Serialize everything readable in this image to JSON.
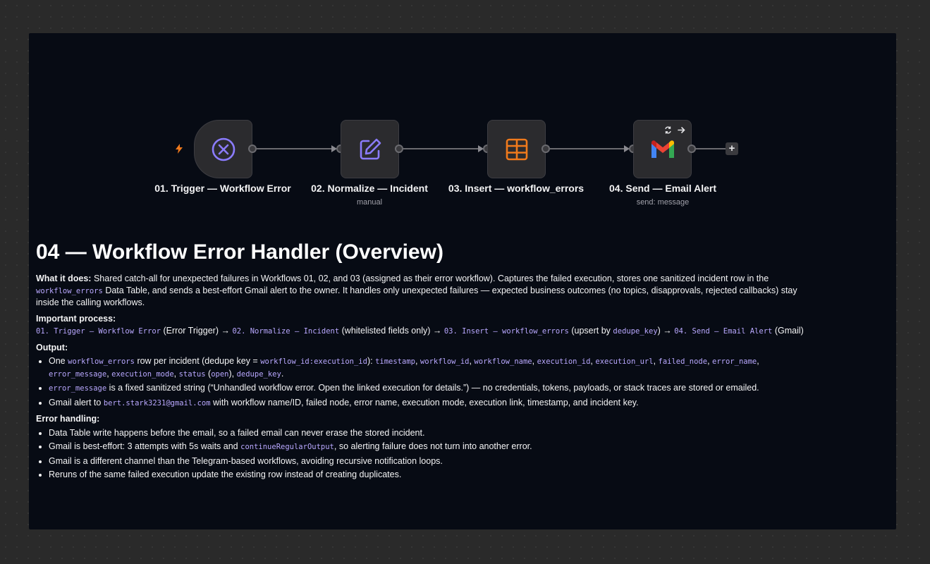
{
  "nodes": [
    {
      "title": "01. Trigger — Workflow Error",
      "subtitle": "",
      "icon": "circle-x-icon",
      "color": "#8b7cff"
    },
    {
      "title": "02. Normalize — Incident",
      "subtitle": "manual",
      "icon": "edit-icon",
      "color": "#8b7cff"
    },
    {
      "title": "03. Insert — workflow_errors",
      "subtitle": "",
      "icon": "table-icon",
      "color": "#f07a1c"
    },
    {
      "title": "04. Send — Email Alert",
      "subtitle": "send: message",
      "icon": "gmail-icon",
      "color": "#ea4335"
    }
  ],
  "overview": {
    "title": "04 — Workflow Error Handler (Overview)",
    "what": {
      "label": "What it does:",
      "text": "Shared catch-all for unexpected failures in Workflows 01, 02, and 03 (assigned as their error workflow). Captures the failed execution, stores one sanitized incident row in the",
      "code": "workflow_errors",
      "text2": "Data Table, and sends a best-effort Gmail alert to the owner. It handles only unexpected failures — expected business outcomes (no topics, disapprovals, rejected callbacks) stay inside the calling workflows."
    },
    "process": {
      "label": "Important process:",
      "c1": "01. Trigger — Workflow Error",
      "t1": "(Error Trigger) →",
      "c2": "02. Normalize — Incident",
      "t2": "(whitelisted fields only) →",
      "c3": "03. Insert — workflow_errors",
      "t3": "(upsert by",
      "c4": "dedupe_key",
      "t4": ") →",
      "c5": "04. Send — Email Alert",
      "t5": "(Gmail)"
    },
    "output": {
      "label": "Output:",
      "b1_t1": "One",
      "b1_c1": "workflow_errors",
      "b1_t2": "row per incident (dedupe key =",
      "b1_c2": "workflow_id:execution_id",
      "b1_t3": "):",
      "b1_fields": [
        "timestamp",
        "workflow_id",
        "workflow_name",
        "execution_id",
        "execution_url",
        "failed_node",
        "error_name",
        "error_message",
        "execution_mode",
        "status"
      ],
      "b1_status_open": "open",
      "b1_last": "dedupe_key",
      "b2_c": "error_message",
      "b2_t": "is a fixed sanitized string (“Unhandled workflow error. Open the linked execution for details.”) — no credentials, tokens, payloads, or stack traces are stored or emailed.",
      "b3_t1": "Gmail alert to",
      "b3_c": "bert.stark3231@gmail.com",
      "b3_t2": "with workflow name/ID, failed node, error name, execution mode, execution link, timestamp, and incident key."
    },
    "errors": {
      "label": "Error handling:",
      "e1": "Data Table write happens before the email, so a failed email can never erase the stored incident.",
      "e2_t1": "Gmail is best-effort: 3 attempts with 5s waits and",
      "e2_c": "continueRegularOutput",
      "e2_t2": ", so alerting failure does not turn into another error.",
      "e3": "Gmail is a different channel than the Telegram-based workflows, avoiding recursive notification loops.",
      "e4": "Reruns of the same failed execution update the existing row instead of creating duplicates."
    }
  }
}
